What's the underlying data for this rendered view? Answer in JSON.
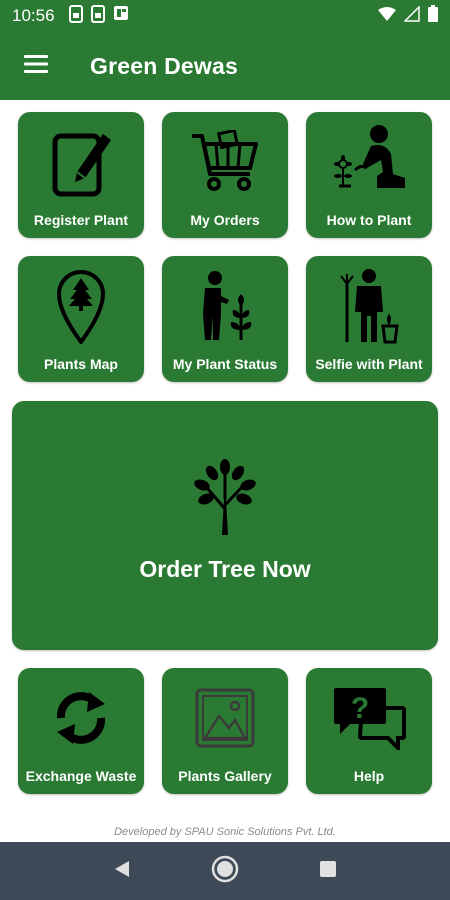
{
  "status_bar": {
    "time": "10:56",
    "left_icons": [
      "sim-card-icon",
      "sim-card-icon",
      "news-icon"
    ],
    "right_icons": [
      "wifi-icon",
      "signal-icon",
      "battery-icon"
    ]
  },
  "app_bar": {
    "menu_icon": "hamburger-menu-icon",
    "title": "Green Dewas"
  },
  "tiles_row1": [
    {
      "label": "Register Plant",
      "icon": "notepad-pencil-icon"
    },
    {
      "label": "My Orders",
      "icon": "shopping-cart-icon"
    },
    {
      "label": "How to Plant",
      "icon": "person-planting-icon"
    }
  ],
  "tiles_row2": [
    {
      "label": "Plants Map",
      "icon": "map-pin-tree-icon"
    },
    {
      "label": "My Plant Status",
      "icon": "person-watering-plant-icon"
    },
    {
      "label": "Selfie with Plant",
      "icon": "person-with-plant-icon"
    }
  ],
  "order_tile": {
    "label": "Order Tree Now",
    "icon": "tree-icon"
  },
  "tiles_row3": [
    {
      "label": "Exchange Waste",
      "icon": "recycle-arrows-icon"
    },
    {
      "label": "Plants Gallery",
      "icon": "image-gallery-icon"
    },
    {
      "label": "Help",
      "icon": "question-chat-icon"
    }
  ],
  "footer": {
    "credit": "Developed by SPAU Sonic Solutions Pvt. Ltd."
  },
  "colors": {
    "primary_green": "#2a7a33",
    "nav_bar": "#3e4a57"
  }
}
